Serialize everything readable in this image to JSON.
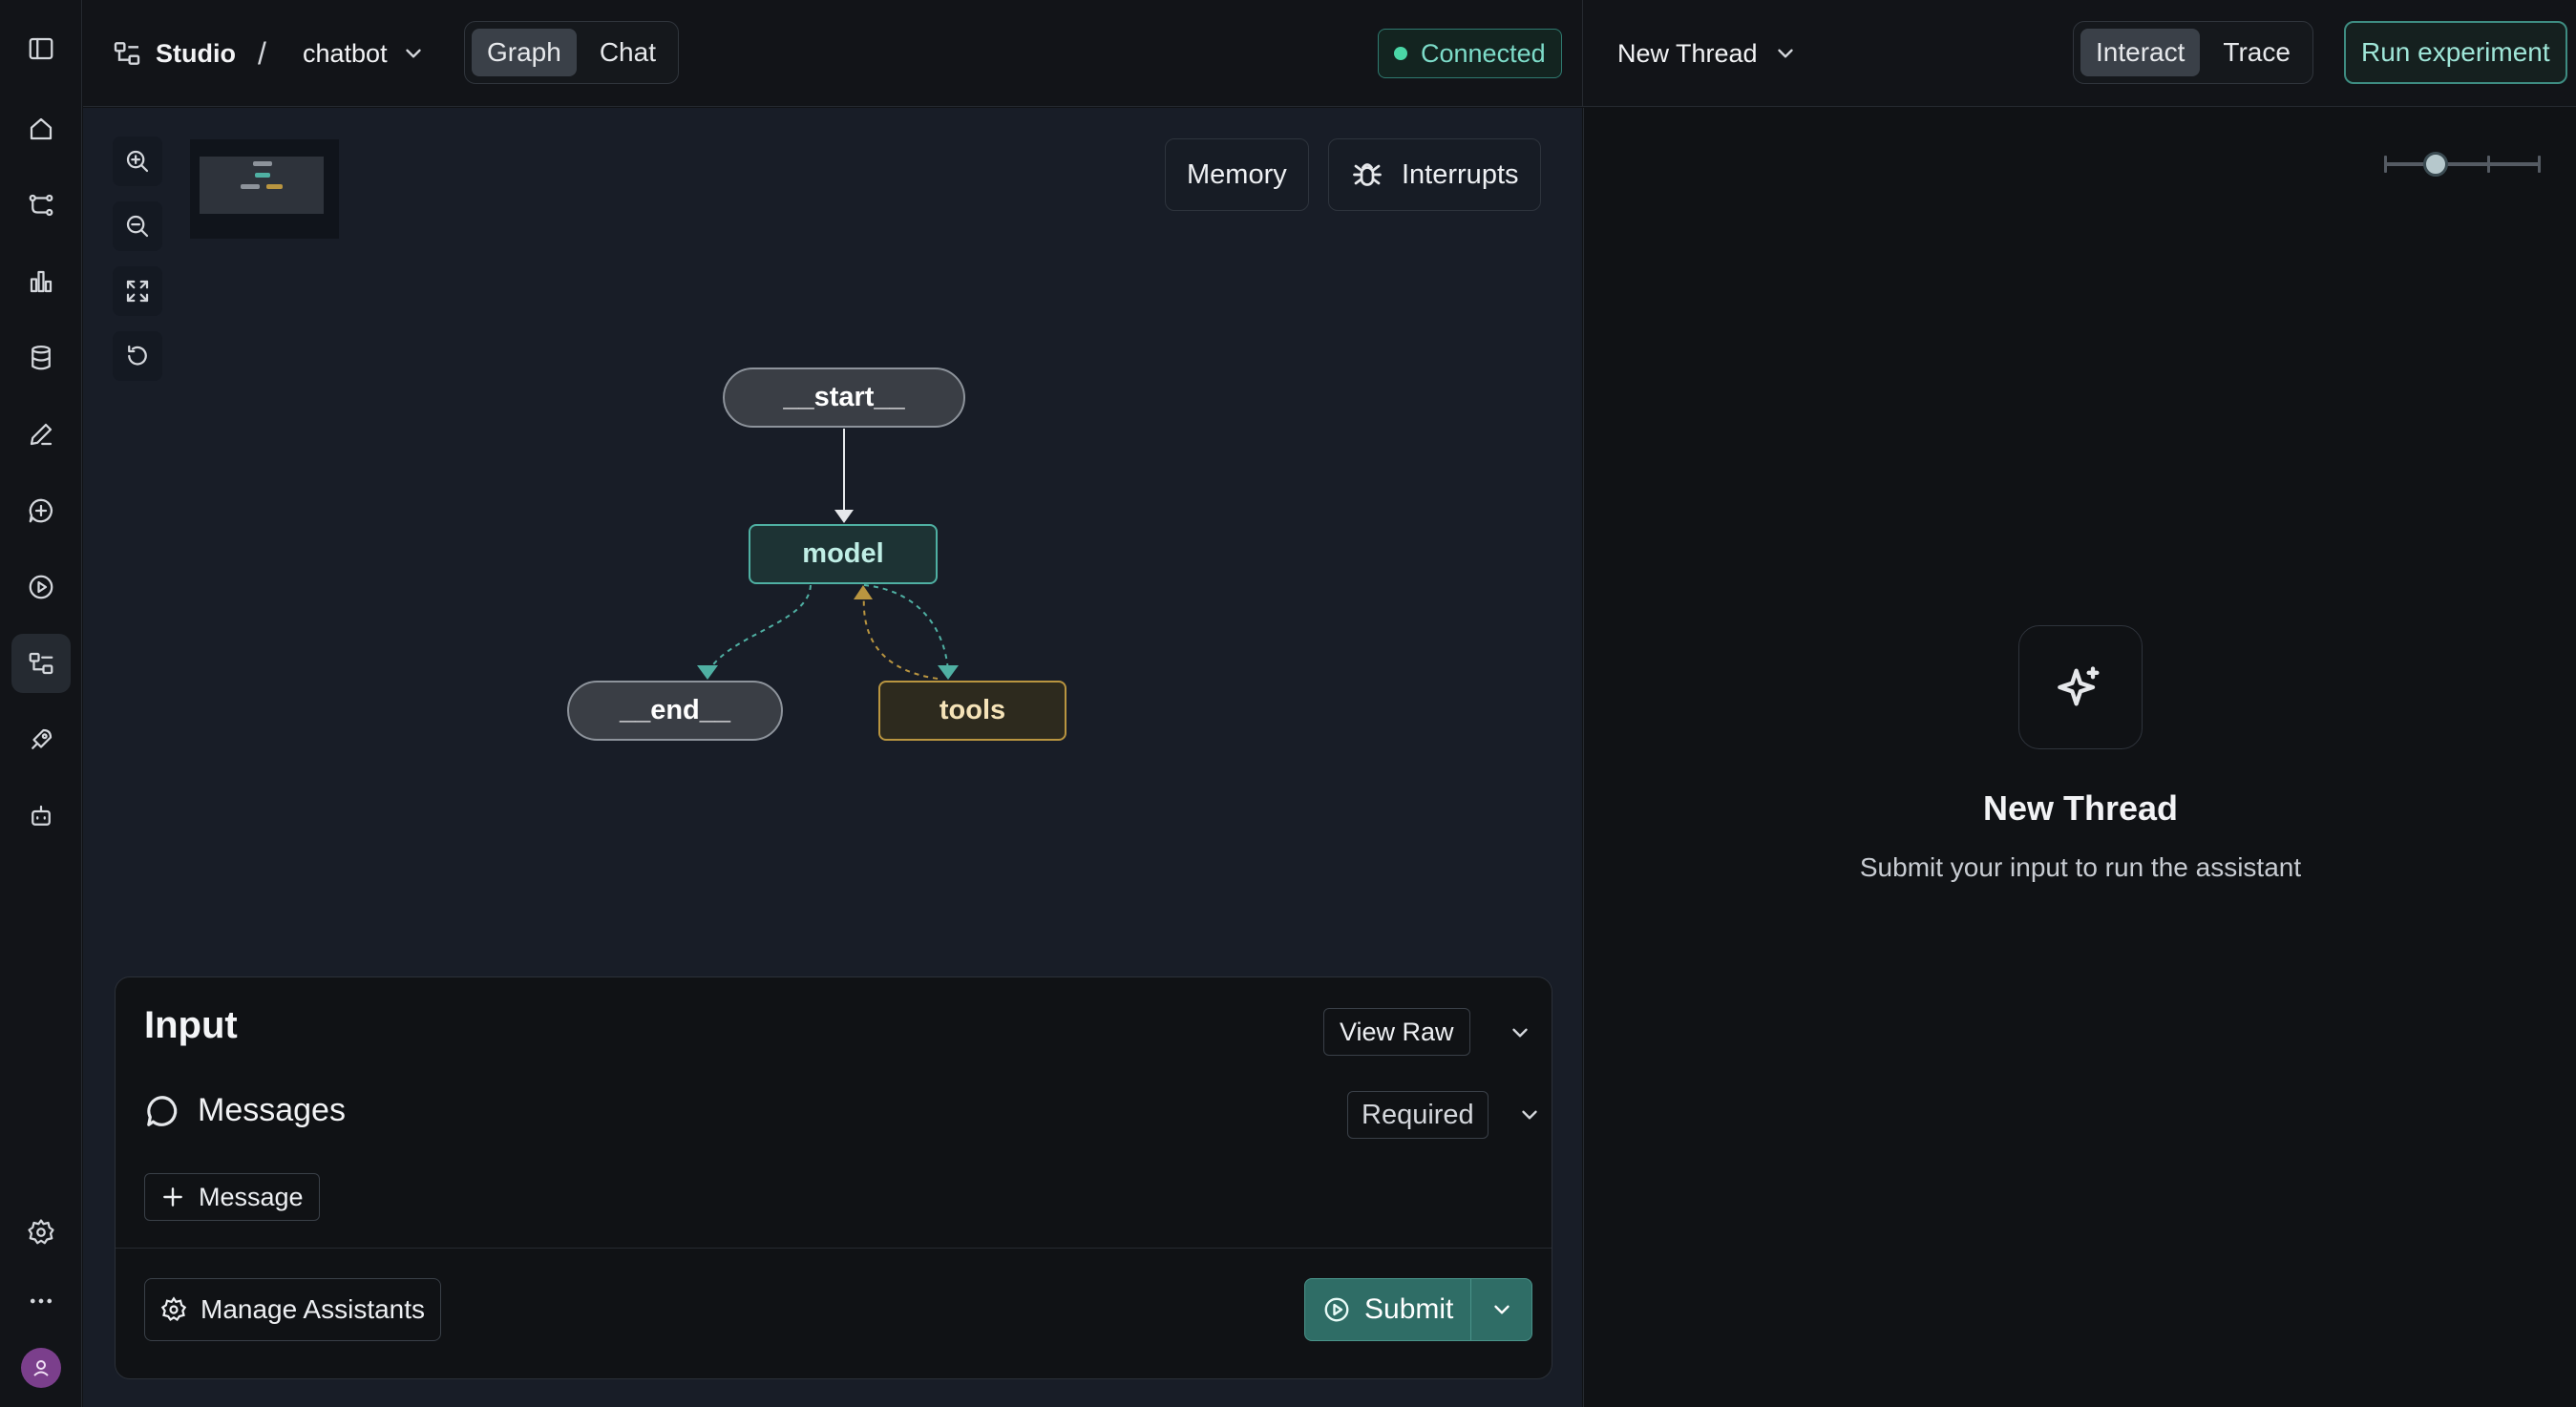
{
  "rail": {
    "items": [
      "sidebar-toggle-icon",
      "home-icon",
      "workflow-icon",
      "chart-icon",
      "database-icon",
      "pen-icon",
      "chat-add-icon",
      "play-icon",
      "studio-icon",
      "rocket-icon",
      "bot-icon"
    ],
    "active": "studio-icon",
    "bottom": [
      "settings-icon",
      "more-icon",
      "avatar"
    ]
  },
  "topbar": {
    "studio_label": "Studio",
    "separator": "/",
    "graph_name": "chatbot",
    "view_tabs": [
      "Graph",
      "Chat"
    ],
    "active_view": "Graph",
    "status": "Connected",
    "thread_label": "New Thread",
    "mode_tabs": [
      "Interact",
      "Trace"
    ],
    "active_mode": "Interact",
    "run_experiment": "Run experiment"
  },
  "canvas": {
    "memory_label": "Memory",
    "interrupts_label": "Interrupts",
    "nodes": {
      "start": "__start__",
      "model": "model",
      "end": "__end__",
      "tools": "tools"
    }
  },
  "input_panel": {
    "title": "Input",
    "view_raw": "View Raw",
    "messages_label": "Messages",
    "required_label": "Required",
    "add_message": "Message",
    "manage_assistants": "Manage Assistants",
    "submit": "Submit"
  },
  "thread_pane": {
    "title": "New Thread",
    "subtitle": "Submit your input to run the assistant"
  },
  "colors": {
    "accent_teal": "#4fb0a3",
    "tools_gold": "#b99540",
    "connected_green": "#4ad6a6",
    "avatar_purple": "#7b3f8c"
  }
}
